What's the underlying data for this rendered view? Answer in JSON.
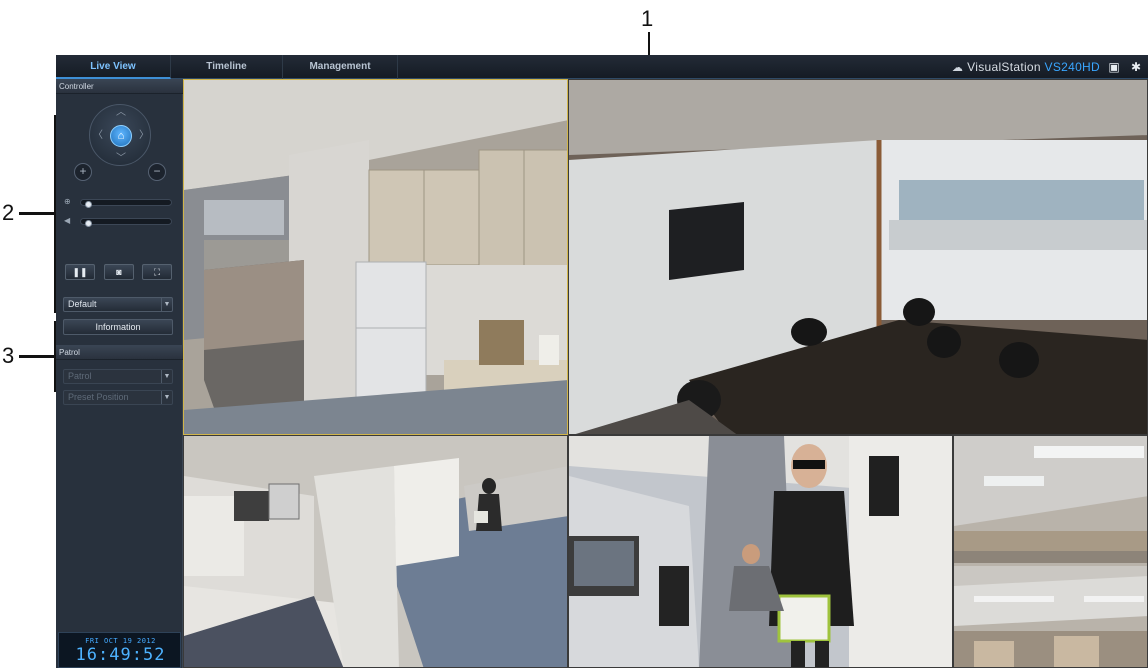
{
  "callouts": [
    "1",
    "2",
    "3"
  ],
  "app": {
    "tabs": [
      {
        "label": "Live View",
        "active": true
      },
      {
        "label": "Timeline",
        "active": false
      },
      {
        "label": "Management",
        "active": false
      }
    ],
    "brand": {
      "name": "VisualStation",
      "model": "VS240HD"
    },
    "top_icons": [
      "camera-icon",
      "gear-icon"
    ]
  },
  "sidebar": {
    "controller_label": "Controller",
    "zoom_icon": "zoom-icon",
    "volume_icon": "volume-icon",
    "zoom_in": "+",
    "zoom_out": "−",
    "zoom_level": 0.0,
    "volume_level": 0.0,
    "buttons": [
      {
        "name": "pause-button",
        "label": "❚❚"
      },
      {
        "name": "snapshot-button",
        "label": "◙"
      },
      {
        "name": "fullscreen-button",
        "label": "⛶"
      }
    ],
    "profile_select": "Default",
    "information_label": "Information",
    "patrol_label": "Patrol",
    "patrol_select": "Patrol",
    "preset_select": "Preset Position",
    "clock": {
      "date": "FRI  OCT 19 2012",
      "time": "16:49:52"
    }
  },
  "colors": {
    "accent": "#3e8fd6",
    "brand_model": "#39a6ff",
    "selected_frame": "#d1b54a",
    "sidebar_bg": "#28313d",
    "clock_text": "#4db2ff"
  }
}
